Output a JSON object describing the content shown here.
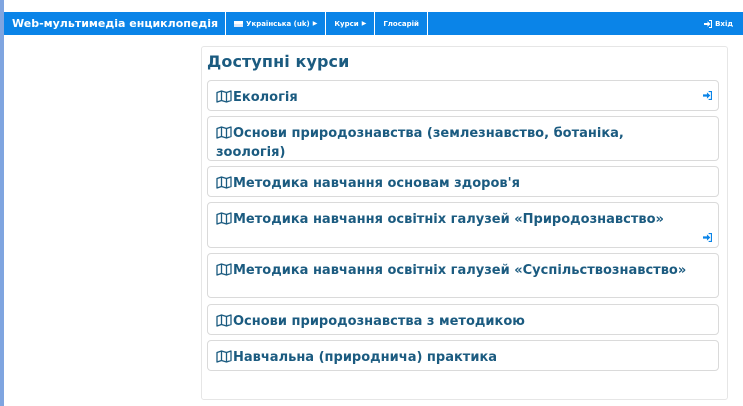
{
  "navbar": {
    "brand": "Web-мультимедіа енциклопедія",
    "language": "Українська (uk)",
    "courses": "Курси",
    "glossary": "Глосарій",
    "login": "Вхід"
  },
  "main": {
    "heading": "Доступні курси",
    "courses": [
      {
        "title": "Екологія",
        "enrol_icon": "login-arrow-icon"
      },
      {
        "title": "Основи природознавства (землезнавство, ботаніка, зоологія)"
      },
      {
        "title": "Методика навчання основам здоров'я"
      },
      {
        "title": "Методика навчання освітніх галузей «Природознавство»",
        "enrol_icon": "login-arrow-icon"
      },
      {
        "title": "Методика навчання освітніх галузей «Суспільствознавство»"
      },
      {
        "title": "Основи природознавства з методикою"
      },
      {
        "title": "Навчальна (природнича) практика"
      }
    ]
  },
  "colors": {
    "navbar": "#0a84e8",
    "title": "#1b5b80",
    "enrol_icon": "#0a84e8"
  }
}
